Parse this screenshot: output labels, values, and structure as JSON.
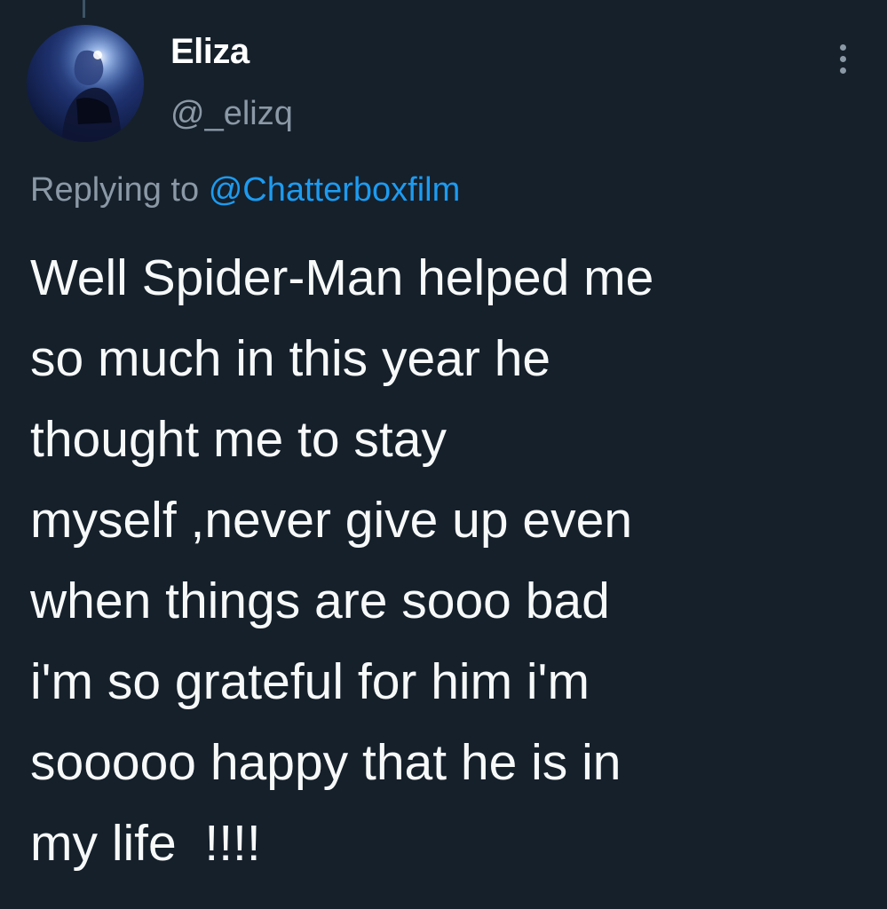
{
  "author": {
    "display_name": "Eliza",
    "handle": "@_elizq",
    "avatar_icon": "profile-photo"
  },
  "reply": {
    "prefix": "Replying to",
    "mention": "@Chatterboxfilm"
  },
  "tweet": {
    "lines": [
      "Well Spider-Man helped me",
      "so much in this year he",
      "thought me to stay",
      "myself ,never give up even",
      "when things are sooo bad",
      "i'm so grateful for him i'm",
      "sooooo happy that he is in",
      "my life  !!!!"
    ]
  },
  "more_icon": "more-options-icon",
  "colors": {
    "background": "#15202b",
    "secondary_text": "#8b98a5",
    "link": "#1d9bf0",
    "primary_text": "#f7f9f9"
  }
}
